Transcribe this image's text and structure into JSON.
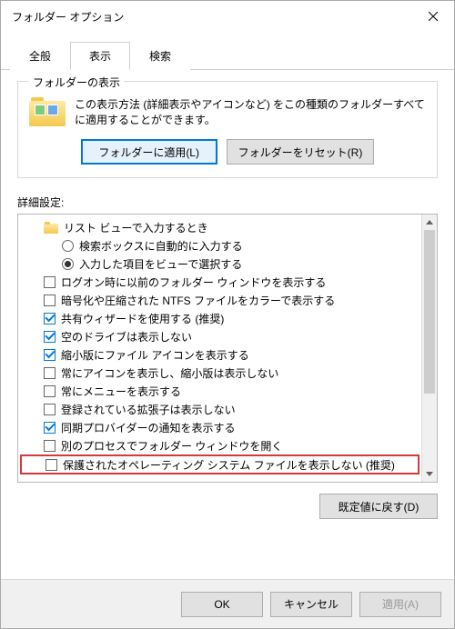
{
  "window": {
    "title": "フォルダー オプション"
  },
  "tabs": {
    "general": "全般",
    "view": "表示",
    "search": "検索"
  },
  "folder_view": {
    "group_title": "フォルダーの表示",
    "desc": "この表示方法 (詳細表示やアイコンなど) をこの種類のフォルダーすべてに適用することができます。",
    "apply_btn": "フォルダーに適用(L)",
    "reset_btn": "フォルダーをリセット(R)"
  },
  "advanced": {
    "label": "詳細設定:",
    "items": [
      {
        "type": "folder",
        "label": "リスト ビューで入力するとき",
        "indent": 1
      },
      {
        "type": "radio",
        "checked": false,
        "label": "検索ボックスに自動的に入力する",
        "indent": 2
      },
      {
        "type": "radio",
        "checked": true,
        "label": "入力した項目をビューで選択する",
        "indent": 2
      },
      {
        "type": "check",
        "checked": false,
        "label": "ログオン時に以前のフォルダー ウィンドウを表示する",
        "indent": 1
      },
      {
        "type": "check",
        "checked": false,
        "label": "暗号化や圧縮された NTFS ファイルをカラーで表示する",
        "indent": 1
      },
      {
        "type": "check",
        "checked": true,
        "label": "共有ウィザードを使用する (推奨)",
        "indent": 1
      },
      {
        "type": "check",
        "checked": true,
        "label": "空のドライブは表示しない",
        "indent": 1
      },
      {
        "type": "check",
        "checked": true,
        "label": "縮小版にファイル アイコンを表示する",
        "indent": 1
      },
      {
        "type": "check",
        "checked": false,
        "label": "常にアイコンを表示し、縮小版は表示しない",
        "indent": 1
      },
      {
        "type": "check",
        "checked": false,
        "label": "常にメニューを表示する",
        "indent": 1
      },
      {
        "type": "check",
        "checked": false,
        "label": "登録されている拡張子は表示しない",
        "indent": 1
      },
      {
        "type": "check",
        "checked": true,
        "label": "同期プロバイダーの通知を表示する",
        "indent": 1
      },
      {
        "type": "check",
        "checked": false,
        "label": "別のプロセスでフォルダー ウィンドウを開く",
        "indent": 1
      },
      {
        "type": "check",
        "checked": false,
        "label": "保護されたオペレーティング システム ファイルを表示しない (推奨)",
        "indent": 1,
        "highlight": true
      }
    ],
    "restore_defaults": "既定値に戻す(D)"
  },
  "footer": {
    "ok": "OK",
    "cancel": "キャンセル",
    "apply": "適用(A)"
  }
}
